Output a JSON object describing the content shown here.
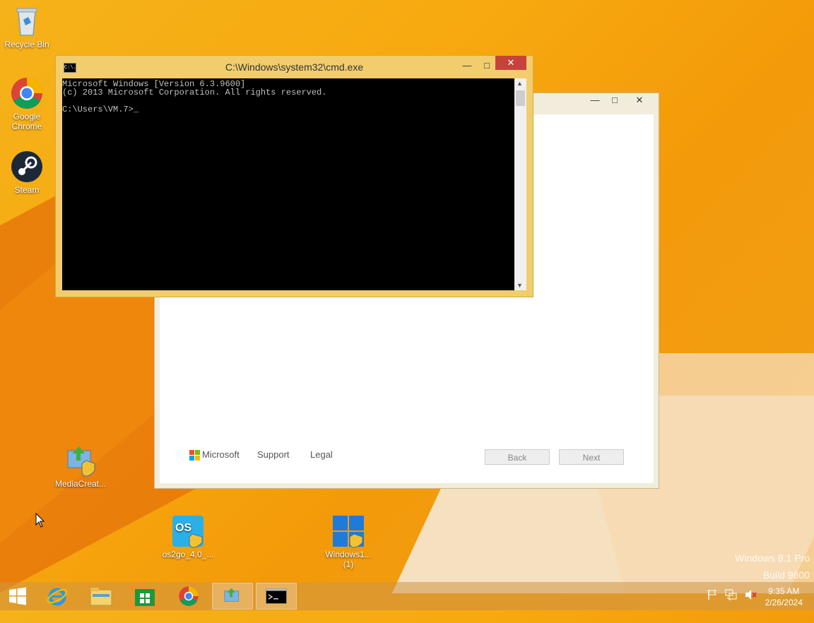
{
  "desktop": {
    "icons": [
      {
        "label": "Recycle Bin"
      },
      {
        "label": "Google Chrome"
      },
      {
        "label": "Steam"
      },
      {
        "label": "MediaCreat..."
      },
      {
        "label": "os2go_4.0_..."
      },
      {
        "label": "Windows1...\n(1)"
      }
    ],
    "watermark_line1": "Windows 8.1 Pro",
    "watermark_line2": "Build 9600"
  },
  "cmd_window": {
    "title": "C:\\Windows\\system32\\cmd.exe",
    "lines": [
      "Microsoft Windows [Version 6.3.9600]",
      "(c) 2013 Microsoft Corporation. All rights reserved.",
      "",
      "C:\\Users\\VM.7>_"
    ],
    "icon_text": "C:\\."
  },
  "setup_window": {
    "footer": {
      "brand": "Microsoft",
      "support": "Support",
      "legal": "Legal",
      "back": "Back",
      "next": "Next"
    }
  },
  "taskbar": {
    "items": [
      "start-button",
      "internet-explorer",
      "file-explorer",
      "store",
      "chrome",
      "media-creation-tool",
      "command-prompt"
    ],
    "time": "9:35 AM",
    "date": "2/26/2024"
  },
  "colors": {
    "desktop_bg": "#f6b21a",
    "cmd_frame": "#f2cd6e",
    "close_red": "#c7423a"
  }
}
